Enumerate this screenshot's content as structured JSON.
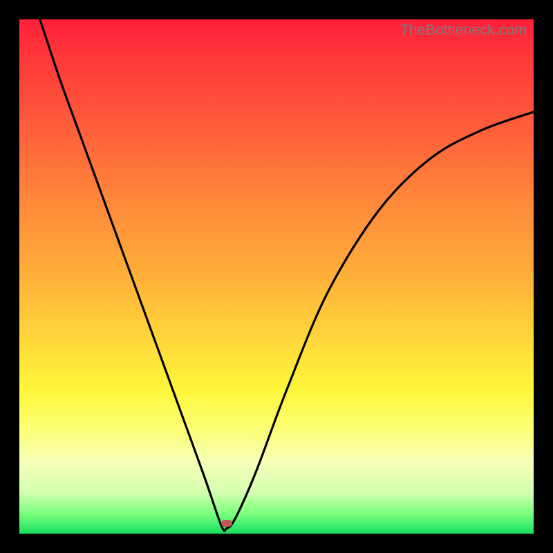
{
  "watermark": "TheBottleneck.com",
  "colors": {
    "frame": "#000000",
    "curve": "#000000",
    "marker": "#c05a50",
    "gradient_top": "#ff1f3a",
    "gradient_bottom": "#18e060"
  },
  "chart_data": {
    "type": "line",
    "title": "",
    "xlabel": "",
    "ylabel": "",
    "xlim": [
      0,
      100
    ],
    "ylim": [
      0,
      100
    ],
    "note": "No axis ticks or labels are shown; values are pixel-fraction estimates of the plotted curve within the plot area. y is measured from the BOTTOM (0) to the TOP (100).",
    "series": [
      {
        "name": "bottleneck-curve",
        "x": [
          4.0,
          8.0,
          12.0,
          16.0,
          20.0,
          24.0,
          28.0,
          32.0,
          36.0,
          39.3,
          40.3,
          42.0,
          46.0,
          52.0,
          60.0,
          70.0,
          80.0,
          90.0,
          100.0
        ],
        "y": [
          100.0,
          88.0,
          77.0,
          66.0,
          55.0,
          44.0,
          33.0,
          22.0,
          11.0,
          1.5,
          1.0,
          3.0,
          12.0,
          28.0,
          47.0,
          63.0,
          73.0,
          78.5,
          82.0
        ]
      }
    ],
    "marker": {
      "x": 40.3,
      "y": 2.0
    },
    "left_branch_start": {
      "x": 4.0,
      "y": 100.0
    },
    "right_branch_end": {
      "x": 100.0,
      "y": 82.0
    }
  }
}
